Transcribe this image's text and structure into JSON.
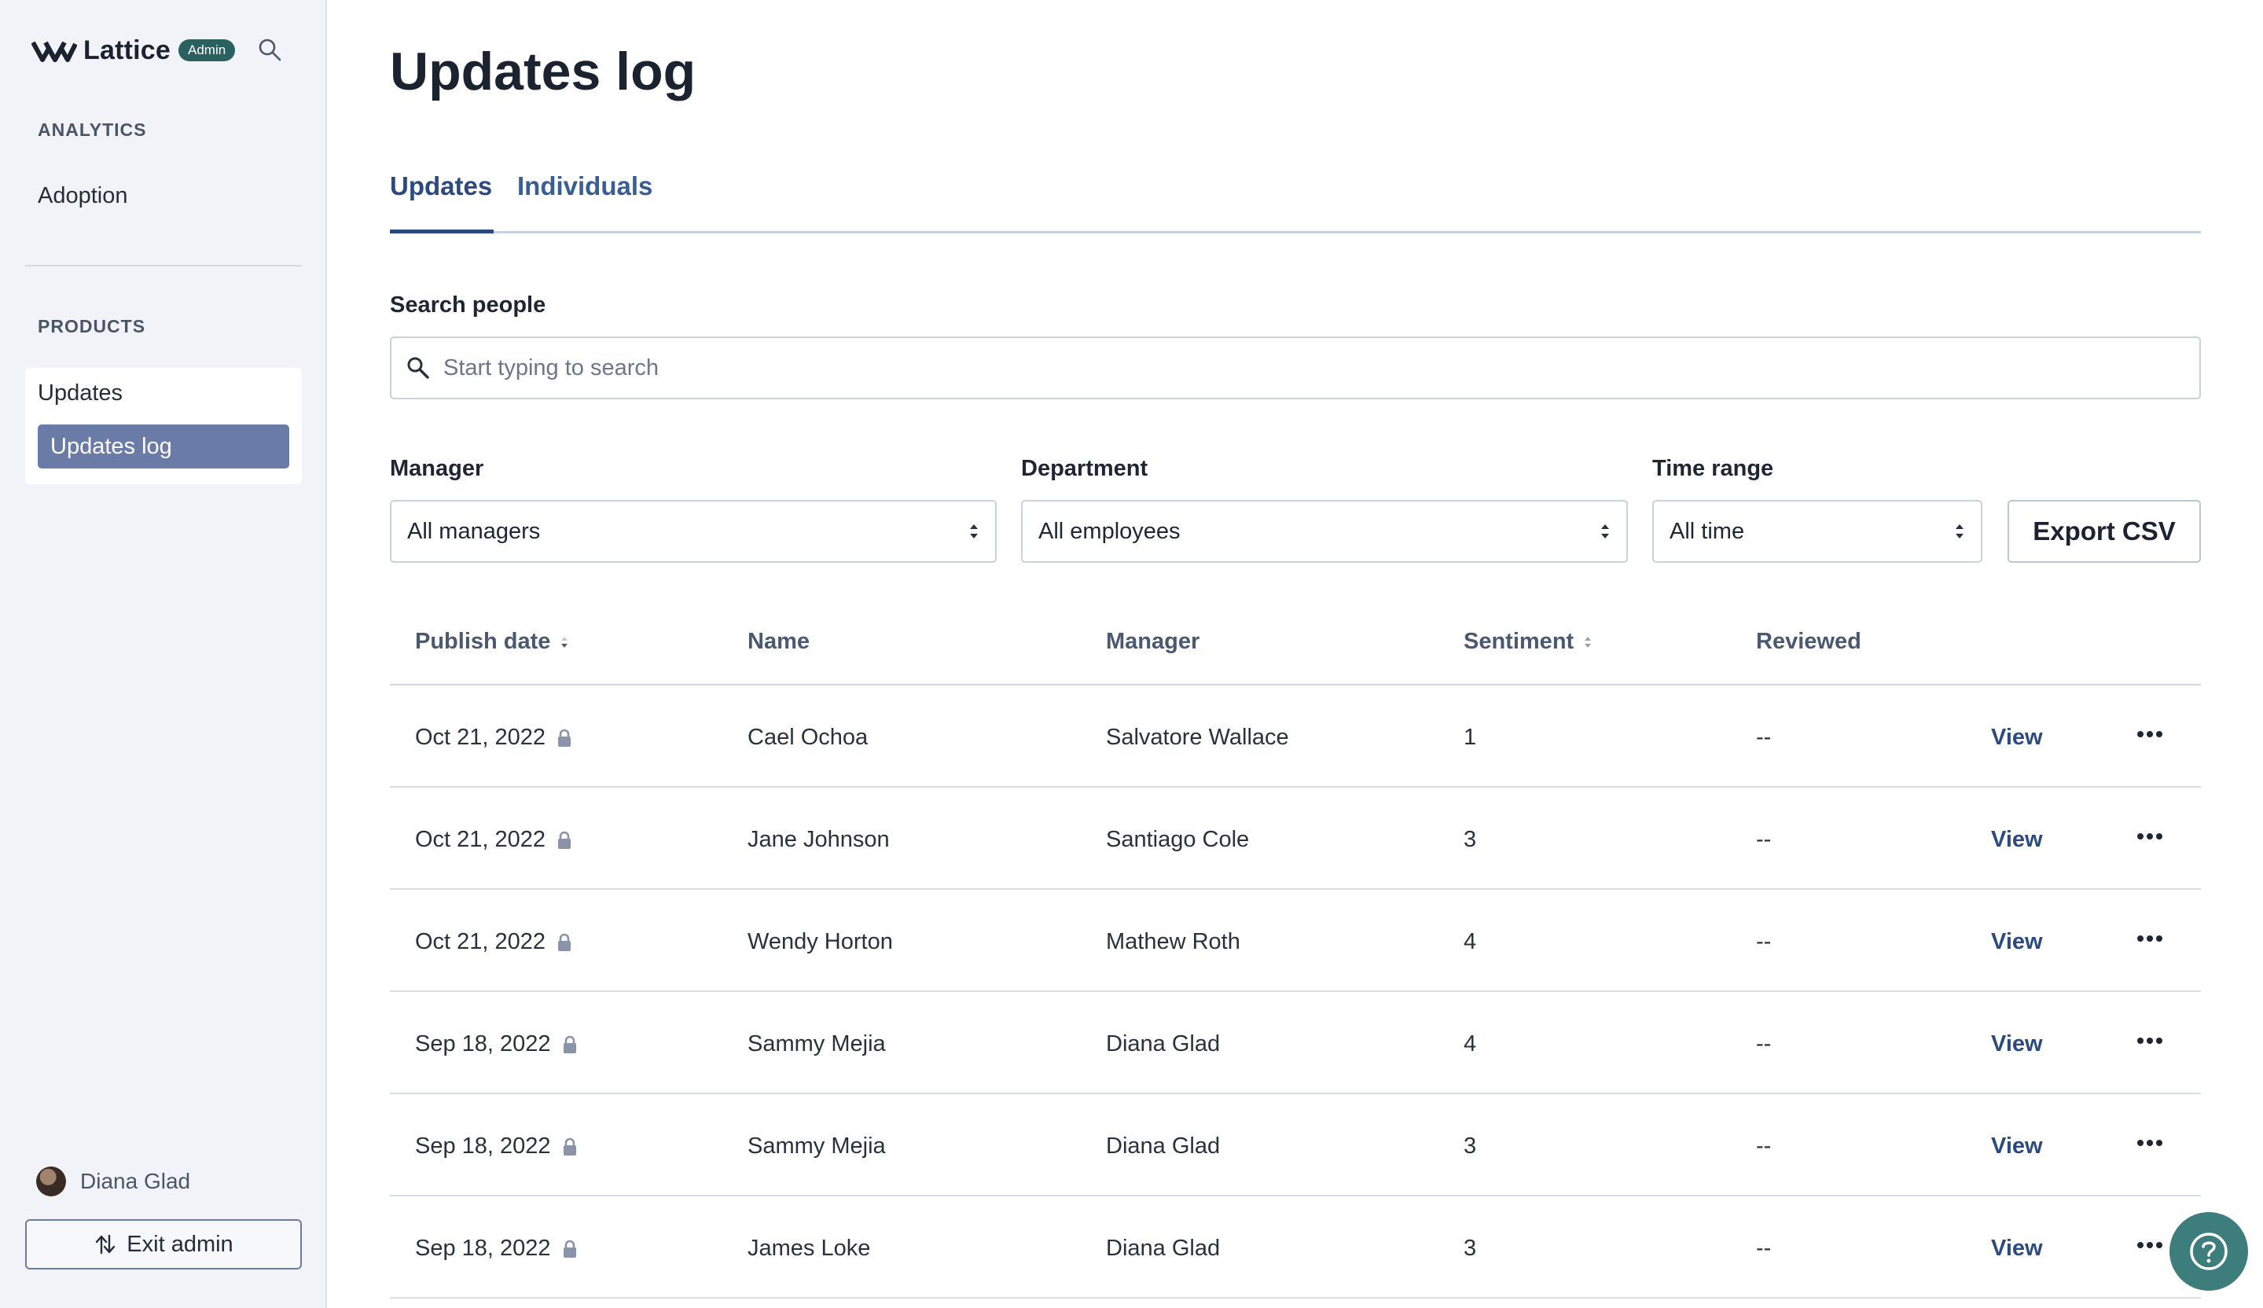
{
  "brand": {
    "name": "Lattice",
    "badge": "Admin"
  },
  "sidebar": {
    "sections": [
      {
        "label": "ANALYTICS",
        "items": [
          {
            "label": "Adoption"
          }
        ]
      },
      {
        "label": "PRODUCTS",
        "items": [
          {
            "label": "Updates"
          },
          {
            "label": "Updates log",
            "active": true
          }
        ]
      }
    ],
    "user": {
      "name": "Diana Glad"
    },
    "exit_label": "Exit admin"
  },
  "page": {
    "title": "Updates log"
  },
  "tabs": [
    {
      "label": "Updates",
      "active": true
    },
    {
      "label": "Individuals",
      "active": false
    }
  ],
  "search": {
    "label": "Search people",
    "placeholder": "Start typing to search",
    "value": ""
  },
  "filters": {
    "manager": {
      "label": "Manager",
      "value": "All managers"
    },
    "department": {
      "label": "Department",
      "value": "All employees"
    },
    "time_range": {
      "label": "Time range",
      "value": "All time"
    },
    "export_label": "Export CSV"
  },
  "table": {
    "columns": [
      "Publish date",
      "Name",
      "Manager",
      "Sentiment",
      "Reviewed"
    ],
    "view_label": "View",
    "rows": [
      {
        "date": "Oct 21, 2022",
        "name": "Cael Ochoa",
        "manager": "Salvatore Wallace",
        "sentiment": "1",
        "reviewed": "--"
      },
      {
        "date": "Oct 21, 2022",
        "name": "Jane Johnson",
        "manager": "Santiago Cole",
        "sentiment": "3",
        "reviewed": "--"
      },
      {
        "date": "Oct 21, 2022",
        "name": "Wendy Horton",
        "manager": "Mathew Roth",
        "sentiment": "4",
        "reviewed": "--"
      },
      {
        "date": "Sep 18, 2022",
        "name": "Sammy Mejia",
        "manager": "Diana Glad",
        "sentiment": "4",
        "reviewed": "--"
      },
      {
        "date": "Sep 18, 2022",
        "name": "Sammy Mejia",
        "manager": "Diana Glad",
        "sentiment": "3",
        "reviewed": "--"
      },
      {
        "date": "Sep 18, 2022",
        "name": "James Loke",
        "manager": "Diana Glad",
        "sentiment": "3",
        "reviewed": "--"
      }
    ]
  },
  "icons": {
    "brand": "lattice-logo-icon",
    "search": "search-icon",
    "lock": "lock-icon",
    "sort": "sort-icon",
    "select": "select-arrows-icon",
    "more": "more-horizontal-icon",
    "exit": "exit-arrows-icon",
    "help": "help-icon"
  },
  "colors": {
    "accent": "#2b4a80",
    "active_nav": "#6b7ba8",
    "badge": "#2a6160",
    "help_button": "#3d7d7c",
    "sidebar_bg": "#f1f3f8"
  }
}
